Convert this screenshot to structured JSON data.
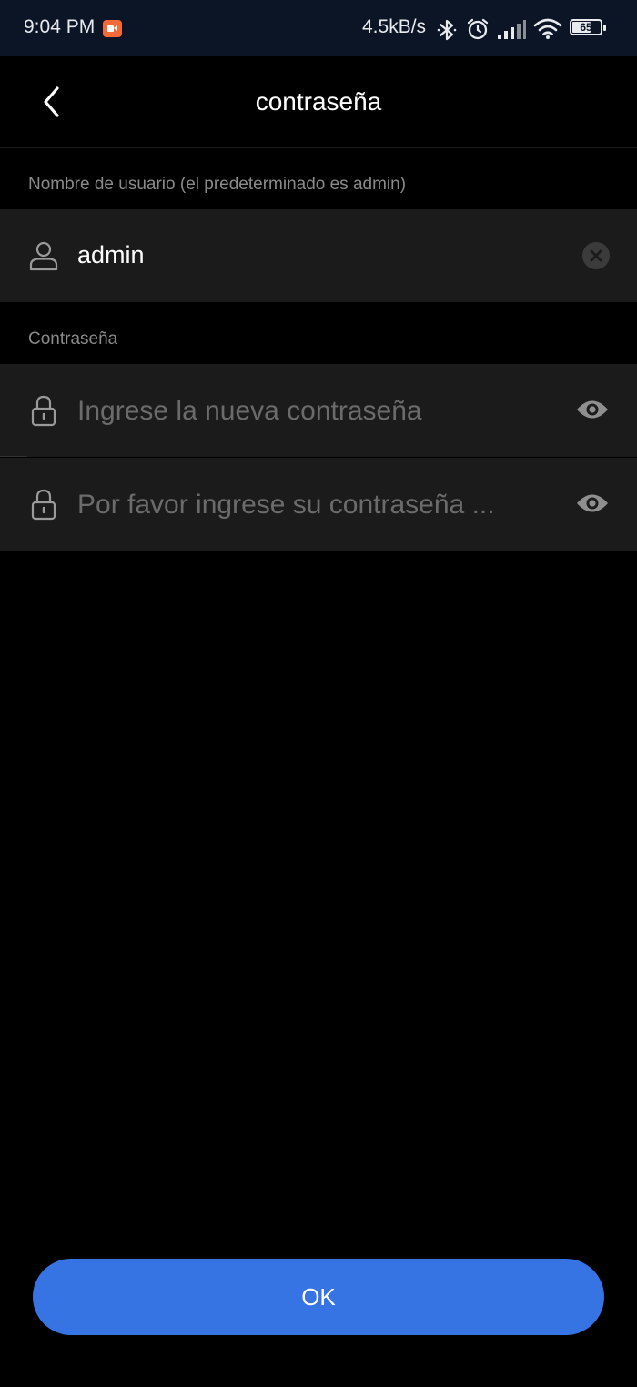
{
  "status_bar": {
    "time": "9:04 PM",
    "net_speed": "4.5kB/s",
    "battery_level": "65",
    "icons": [
      "screen-record-icon",
      "bluetooth-icon",
      "alarm-icon",
      "signal-icon",
      "wifi-icon",
      "battery-icon"
    ]
  },
  "header": {
    "title": "contraseña",
    "back_icon": "chevron-left-icon"
  },
  "username_section": {
    "label": "Nombre de usuario (el predeterminado es admin)",
    "value": "admin",
    "lead_icon": "user-icon",
    "trail_icon": "clear-icon"
  },
  "password_section": {
    "label": "Contraseña",
    "new_password_placeholder": "Ingrese la nueva contraseña",
    "confirm_password_placeholder": "Por favor ingrese su contraseña ...",
    "lead_icon": "lock-icon",
    "trail_icon": "eye-icon"
  },
  "actions": {
    "ok_label": "OK"
  },
  "colors": {
    "accent": "#3673e3",
    "background": "#000000",
    "field_background": "#1b1b1b",
    "status_bar": "#0b1526",
    "placeholder": "#6b6b6b",
    "label": "#8a8a8a"
  }
}
